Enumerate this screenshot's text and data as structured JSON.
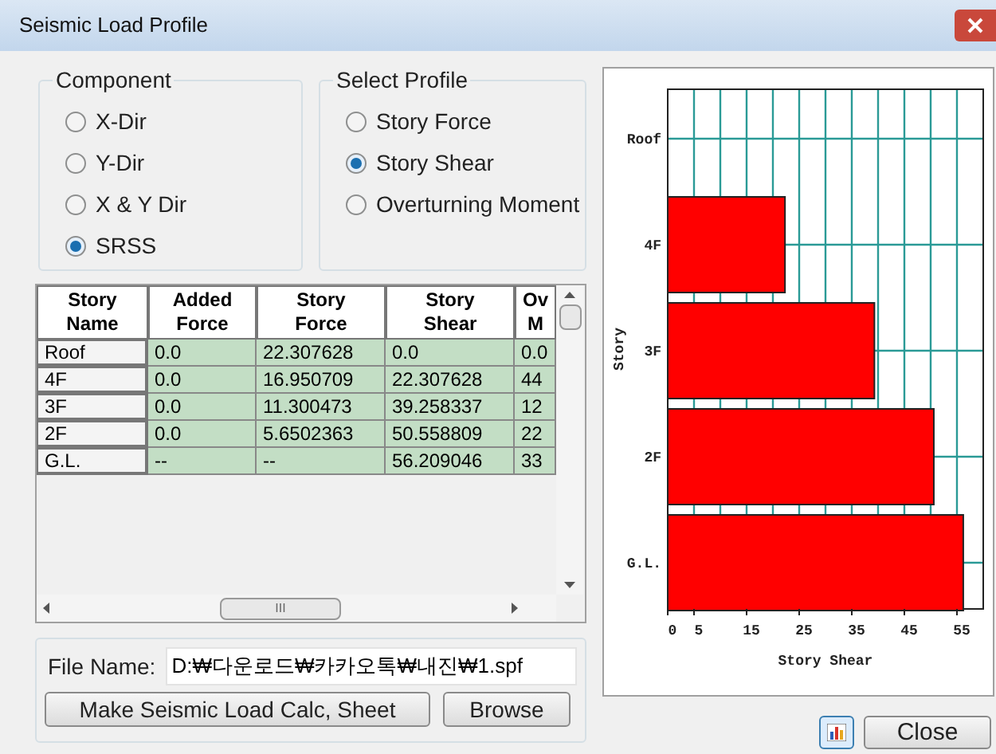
{
  "window": {
    "title": "Seismic Load Profile"
  },
  "component": {
    "title": "Component",
    "options": [
      {
        "label": "X-Dir",
        "selected": false
      },
      {
        "label": "Y-Dir",
        "selected": false
      },
      {
        "label": "X & Y Dir",
        "selected": false
      },
      {
        "label": "SRSS",
        "selected": true
      }
    ]
  },
  "select_profile": {
    "title": "Select Profile",
    "options": [
      {
        "label": "Story Force",
        "selected": false
      },
      {
        "label": "Story Shear",
        "selected": true
      },
      {
        "label": "Overturning Moment",
        "selected": false
      }
    ]
  },
  "table": {
    "columns": [
      "Story Name",
      "Added Force",
      "Story Force",
      "Story Shear",
      "Ov M"
    ],
    "rows": [
      {
        "cells": [
          "Roof",
          "0.0",
          "22.307628",
          "0.0",
          "0.0"
        ]
      },
      {
        "cells": [
          "4F",
          "0.0",
          "16.950709",
          "22.307628",
          "44"
        ]
      },
      {
        "cells": [
          "3F",
          "0.0",
          "11.300473",
          "39.258337",
          "12"
        ]
      },
      {
        "cells": [
          "2F",
          "0.0",
          "5.6502363",
          "50.558809",
          "22"
        ]
      },
      {
        "cells": [
          "G.L.",
          "--",
          "--",
          "56.209046",
          "33"
        ]
      }
    ],
    "scroll_thumb": "III"
  },
  "file": {
    "label": "File Name:",
    "value": "D:₩다운로드₩카카오톡₩내진₩1.spf",
    "make_button": "Make Seismic Load Calc, Sheet",
    "browse_button": "Browse"
  },
  "chart": {
    "chart_data": {
      "type": "bar",
      "orientation": "horizontal",
      "xlabel": "Story Shear",
      "ylabel": "Story",
      "categories": [
        "Roof",
        "4F",
        "3F",
        "2F",
        "G.L."
      ],
      "series": [
        {
          "color": "#ff0000",
          "values": [
            0,
            22.3,
            39.3,
            50.6,
            56.2
          ]
        }
      ],
      "xlim": [
        0,
        60
      ],
      "xticks": [
        0,
        5,
        15,
        25,
        35,
        45,
        55
      ],
      "grid": true
    }
  },
  "close_button": "Close"
}
